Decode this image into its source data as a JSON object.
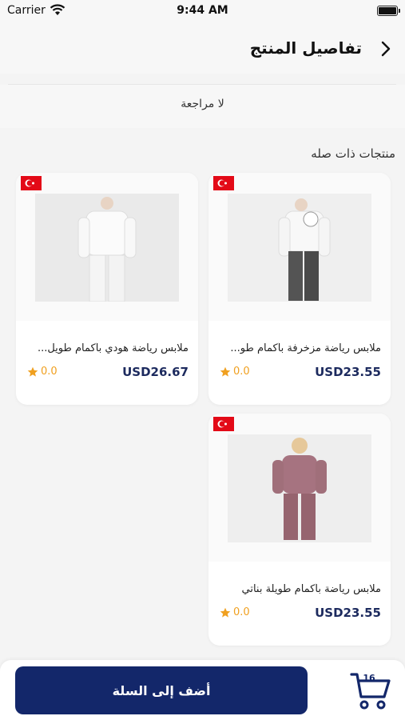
{
  "status_bar": {
    "carrier": "Carrier",
    "time": "9:44 AM"
  },
  "header": {
    "title": "تفاصيل المنتج",
    "back_icon": "chevron-right-icon"
  },
  "reviews": {
    "empty_text": "لا مراجعة"
  },
  "related": {
    "title": "منتجات ذات صله",
    "products": [
      {
        "name": "ملابس رياضة مزخرفة بأكمام طو...",
        "price": "USD23.55",
        "rating": "0.0",
        "origin_flag": "turkey-flag-icon",
        "photo_colors": {
          "top": "#f5f5f5",
          "bottom": "#545454"
        }
      },
      {
        "name": "ملابس رياضة هودي بأكمام طويل...",
        "price": "USD26.67",
        "rating": "0.0",
        "origin_flag": "turkey-flag-icon",
        "photo_colors": {
          "top": "#f7f7f7",
          "bottom": "#f2f2f2"
        }
      },
      {
        "name": "ملابس رياضة بأكمام طويلة بناتي",
        "price": "USD23.55",
        "rating": "0.0",
        "origin_flag": "turkey-flag-icon",
        "photo_colors": {
          "top": "#a67380",
          "bottom": "#96646f"
        }
      }
    ]
  },
  "bottom_bar": {
    "add_to_cart_label": "أضف إلى السلة",
    "cart_count": "16"
  },
  "colors": {
    "primary": "#13276a",
    "price": "#1c2a5e",
    "star": "#f0a020",
    "flag": "#e30a17"
  }
}
